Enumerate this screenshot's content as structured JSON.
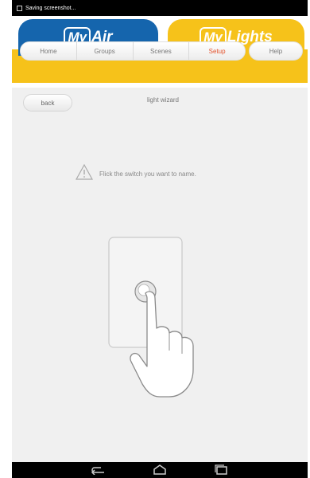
{
  "status_bar": {
    "notification_text": "Saving screenshot..."
  },
  "top_tabs": {
    "myair": {
      "logo_box": "My",
      "logo_rest": "Air"
    },
    "mylights": {
      "logo_box": "My",
      "logo_rest": "Lights"
    }
  },
  "nav": {
    "tabs": [
      {
        "label": "Home"
      },
      {
        "label": "Groups"
      },
      {
        "label": "Scenes"
      },
      {
        "label": "Setup"
      }
    ],
    "active_tab": "Setup",
    "help_label": "Help"
  },
  "screen": {
    "back_label": "back",
    "title": "light wizard",
    "instruction": "Flick the switch you want to name."
  },
  "colors": {
    "myair_blue": "#1565ad",
    "mylights_yellow": "#f6c21a",
    "active_tab_text": "#e2512b"
  },
  "icons": [
    "warning-icon",
    "back-nav-icon",
    "home-nav-icon",
    "recent-apps-icon"
  ]
}
